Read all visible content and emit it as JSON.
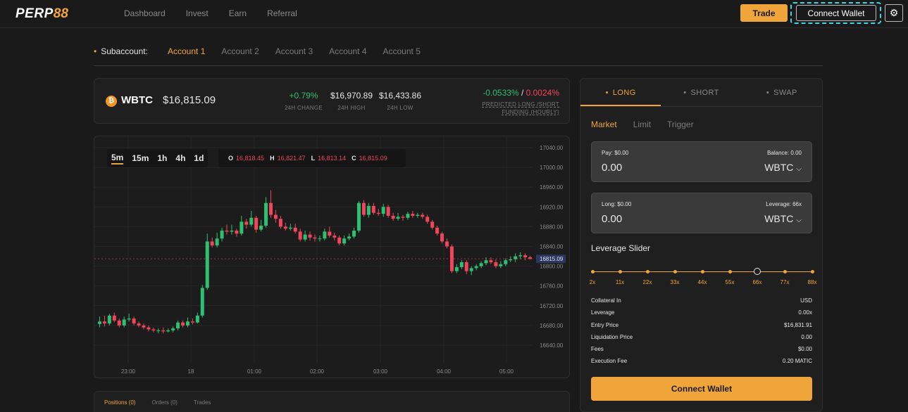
{
  "header": {
    "logo_text": "PERP",
    "logo_num": "88",
    "nav": [
      "Dashboard",
      "Invest",
      "Earn",
      "Referral"
    ],
    "trade_label": "Trade",
    "connect_label": "Connect Wallet",
    "settings_icon": "gear-icon"
  },
  "subaccount": {
    "label": "Subaccount:",
    "accounts": [
      "Account 1",
      "Account 2",
      "Account 3",
      "Account 4",
      "Account 5"
    ],
    "active_index": 0
  },
  "ticker": {
    "symbol": "WBTC",
    "price": "$16,815.09",
    "change": "+0.79%",
    "change_label": "24H CHANGE",
    "high": "$16,970.89",
    "high_label": "24H HIGH",
    "low": "$16,433.86",
    "low_label": "24H LOW",
    "funding_long": "-0.0533%",
    "funding_sep": " / ",
    "funding_short": "0.0024%",
    "funding_label_1": "PREDICTED LONG /SHORT",
    "funding_label_2": "FUNDING (HOURLY)"
  },
  "chart": {
    "timeframes": [
      "5m",
      "15m",
      "1h",
      "4h",
      "1d"
    ],
    "active_timeframe": "5m",
    "ohlc": {
      "o_label": "O",
      "o": "16,818.45",
      "h_label": "H",
      "h": "16,821.47",
      "l_label": "L",
      "l": "16,813.14",
      "c_label": "C",
      "c": "16,815.09"
    },
    "current_price_tag": "16815.09"
  },
  "chart_data": {
    "type": "candlestick",
    "y_ticks": [
      "17040.00",
      "17000.00",
      "16960.00",
      "16920.00",
      "16880.00",
      "16840.00",
      "16800.00",
      "16760.00",
      "16720.00",
      "16680.00",
      "16640.00"
    ],
    "ylim": [
      16613,
      17050
    ],
    "x_ticks": [
      "23:00",
      "18",
      "01:00",
      "02:00",
      "03:00",
      "04:00",
      "05:00"
    ],
    "colors": {
      "up": "#2fbf71",
      "down": "#f0455a"
    },
    "candles": [
      [
        16683,
        16688,
        16698,
        16676
      ],
      [
        16688,
        16684,
        16700,
        16678
      ],
      [
        16684,
        16700,
        16704,
        16680
      ],
      [
        16700,
        16690,
        16706,
        16686
      ],
      [
        16690,
        16680,
        16694,
        16676
      ],
      [
        16680,
        16692,
        16698,
        16676
      ],
      [
        16692,
        16694,
        16704,
        16688
      ],
      [
        16694,
        16684,
        16698,
        16680
      ],
      [
        16684,
        16680,
        16688,
        16676
      ],
      [
        16680,
        16676,
        16684,
        16672
      ],
      [
        16676,
        16672,
        16680,
        16668
      ],
      [
        16672,
        16670,
        16676,
        16666
      ],
      [
        16670,
        16670,
        16674,
        16664
      ],
      [
        16670,
        16668,
        16676,
        16664
      ],
      [
        16668,
        16670,
        16674,
        16666
      ],
      [
        16670,
        16674,
        16678,
        16666
      ],
      [
        16674,
        16686,
        16690,
        16670
      ],
      [
        16686,
        16680,
        16690,
        16676
      ],
      [
        16680,
        16688,
        16696,
        16676
      ],
      [
        16688,
        16686,
        16694,
        16682
      ],
      [
        16686,
        16700,
        16706,
        16684
      ],
      [
        16700,
        16756,
        16762,
        16696
      ],
      [
        16756,
        16850,
        16866,
        16752
      ],
      [
        16850,
        16842,
        16858,
        16838
      ],
      [
        16842,
        16856,
        16868,
        16838
      ],
      [
        16856,
        16872,
        16878,
        16850
      ],
      [
        16872,
        16870,
        16884,
        16864
      ],
      [
        16870,
        16872,
        16884,
        16864
      ],
      [
        16872,
        16866,
        16876,
        16860
      ],
      [
        16866,
        16890,
        16902,
        16862
      ],
      [
        16890,
        16884,
        16896,
        16876
      ],
      [
        16884,
        16898,
        16912,
        16880
      ],
      [
        16898,
        16874,
        16902,
        16868
      ],
      [
        16874,
        16882,
        16894,
        16870
      ],
      [
        16882,
        16928,
        16940,
        16878
      ],
      [
        16928,
        16904,
        16954,
        16898
      ],
      [
        16904,
        16896,
        16914,
        16888
      ],
      [
        16896,
        16880,
        16902,
        16876
      ],
      [
        16880,
        16876,
        16888,
        16872
      ],
      [
        16876,
        16878,
        16886,
        16872
      ],
      [
        16878,
        16870,
        16886,
        16866
      ],
      [
        16870,
        16854,
        16876,
        16850
      ],
      [
        16854,
        16864,
        16872,
        16850
      ],
      [
        16864,
        16858,
        16870,
        16852
      ],
      [
        16858,
        16856,
        16864,
        16850
      ],
      [
        16856,
        16856,
        16862,
        16850
      ],
      [
        16856,
        16870,
        16876,
        16852
      ],
      [
        16870,
        16862,
        16880,
        16858
      ],
      [
        16862,
        16858,
        16868,
        16852
      ],
      [
        16858,
        16846,
        16862,
        16842
      ],
      [
        16846,
        16856,
        16862,
        16842
      ],
      [
        16856,
        16860,
        16866,
        16852
      ],
      [
        16860,
        16872,
        16878,
        16856
      ],
      [
        16872,
        16928,
        16932,
        16868
      ],
      [
        16928,
        16904,
        16934,
        16900
      ],
      [
        16904,
        16922,
        16928,
        16898
      ],
      [
        16922,
        16908,
        16928,
        16904
      ],
      [
        16908,
        16906,
        16916,
        16902
      ],
      [
        16906,
        16920,
        16926,
        16900
      ],
      [
        16920,
        16902,
        16924,
        16898
      ],
      [
        16902,
        16896,
        16908,
        16892
      ],
      [
        16896,
        16900,
        16908,
        16892
      ],
      [
        16900,
        16898,
        16904,
        16892
      ],
      [
        16898,
        16906,
        16910,
        16894
      ],
      [
        16906,
        16902,
        16912,
        16898
      ],
      [
        16902,
        16904,
        16908,
        16898
      ],
      [
        16904,
        16900,
        16908,
        16896
      ],
      [
        16900,
        16890,
        16904,
        16886
      ],
      [
        16890,
        16878,
        16894,
        16874
      ],
      [
        16878,
        16866,
        16882,
        16862
      ],
      [
        16866,
        16850,
        16870,
        16846
      ],
      [
        16850,
        16840,
        16856,
        16836
      ],
      [
        16840,
        16790,
        16844,
        16786
      ],
      [
        16790,
        16798,
        16804,
        16786
      ],
      [
        16798,
        16808,
        16812,
        16794
      ],
      [
        16808,
        16790,
        16812,
        16784
      ],
      [
        16790,
        16796,
        16800,
        16782
      ],
      [
        16796,
        16800,
        16804,
        16792
      ],
      [
        16800,
        16806,
        16810,
        16796
      ],
      [
        16806,
        16812,
        16818,
        16802
      ],
      [
        16812,
        16808,
        16818,
        16804
      ],
      [
        16808,
        16800,
        16814,
        16796
      ],
      [
        16800,
        16804,
        16810,
        16796
      ],
      [
        16804,
        16812,
        16816,
        16800
      ],
      [
        16812,
        16814,
        16820,
        16808
      ],
      [
        16814,
        16820,
        16826,
        16808
      ],
      [
        16820,
        16822,
        16828,
        16814
      ],
      [
        16822,
        16818,
        16826,
        16812
      ],
      [
        16818,
        16815,
        16821,
        16813
      ]
    ]
  },
  "bottom_tabs": [
    "Positions (0)",
    "Orders (0)",
    "Trades"
  ],
  "panel": {
    "tabs": [
      "LONG",
      "SHORT",
      "SWAP"
    ],
    "order_types": [
      "Market",
      "Limit",
      "Trigger"
    ],
    "pay": {
      "label": "Pay: $0.00",
      "balance": "Balance: 0.00",
      "value": "0.00",
      "token": "WBTC"
    },
    "long": {
      "label": "Long: $0.00",
      "leverage": "Leverage: 66x",
      "value": "0.00",
      "token": "WBTC"
    },
    "leverage_title": "Leverage Slider",
    "leverage_marks": [
      "2x",
      "11x",
      "22x",
      "33x",
      "44x",
      "55x",
      "66x",
      "77x",
      "88x"
    ],
    "leverage_value": "66x",
    "details": [
      {
        "label": "Collateral In",
        "value": "USD"
      },
      {
        "label": "Leverage",
        "value": "0.00x"
      },
      {
        "label": "Entry Price",
        "value": "$16,831.91"
      },
      {
        "label": "Liquidation Price",
        "value": "0.00"
      },
      {
        "label": "Fees",
        "value": "$0.00"
      },
      {
        "label": "Execution Fee",
        "value": "0.20 MATIC"
      }
    ],
    "connect_label": "Connect Wallet"
  }
}
